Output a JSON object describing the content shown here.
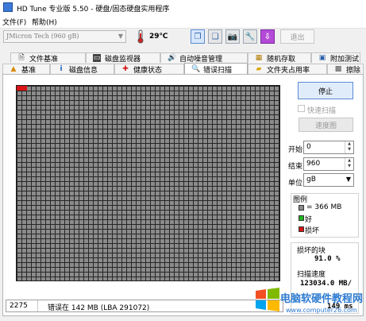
{
  "window": {
    "title": "HD Tune 专业版 5.50 - 硬盘/固态硬盘实用程序"
  },
  "menu": {
    "file": "文件(F)",
    "help": "帮助(H)"
  },
  "toolbar": {
    "drive": "JMicron Tech (960 gB)",
    "temperature": "29℃",
    "exit_label": "退出"
  },
  "tabs_top": [
    {
      "label": "文件基准",
      "icon": "file-bench-icon"
    },
    {
      "label": "磁盘监视器",
      "icon": "monitor-icon"
    },
    {
      "label": "自动噪音管理",
      "icon": "speaker-icon"
    },
    {
      "label": "随机存取",
      "icon": "random-access-icon"
    },
    {
      "label": "附加测试",
      "icon": "extra-tests-icon"
    }
  ],
  "tabs_bottom": [
    {
      "label": "基准",
      "icon": "benchmark-icon"
    },
    {
      "label": "磁盘信息",
      "icon": "info-icon"
    },
    {
      "label": "健康状态",
      "icon": "health-icon"
    },
    {
      "label": "错误扫描",
      "icon": "search-icon",
      "active": true
    },
    {
      "label": "文件夹占用率",
      "icon": "folder-icon"
    },
    {
      "label": "擦除",
      "icon": "erase-icon"
    }
  ],
  "scan": {
    "stop_label": "停止",
    "quick_scan_label": "快速扫描",
    "quick_scan_checked": false,
    "speed_map_label": "速度图",
    "start_label": "开始",
    "start_value": "0",
    "end_label": "结束",
    "end_value": "960",
    "unit_label": "单位",
    "unit_value": "gB"
  },
  "legend": {
    "title": "图例",
    "block_label": "= 366 MB",
    "good_label": "好",
    "bad_label": "损坏",
    "colors": {
      "block": "#8b8b8b",
      "good": "#22b422",
      "bad": "#d81414"
    }
  },
  "stats": {
    "bad_blocks_label": "损坏的块",
    "bad_blocks_value": "91.0 %",
    "scan_speed_label": "扫描速度",
    "scan_speed_value": "123034.0 MB/",
    "extra_value": "149 ms"
  },
  "status": {
    "count": "2275",
    "message": "错误在 142 MB (LBA 291072)"
  },
  "watermark": {
    "text1": "电脑软硬件教程网",
    "text2": "www.computer26.com"
  }
}
